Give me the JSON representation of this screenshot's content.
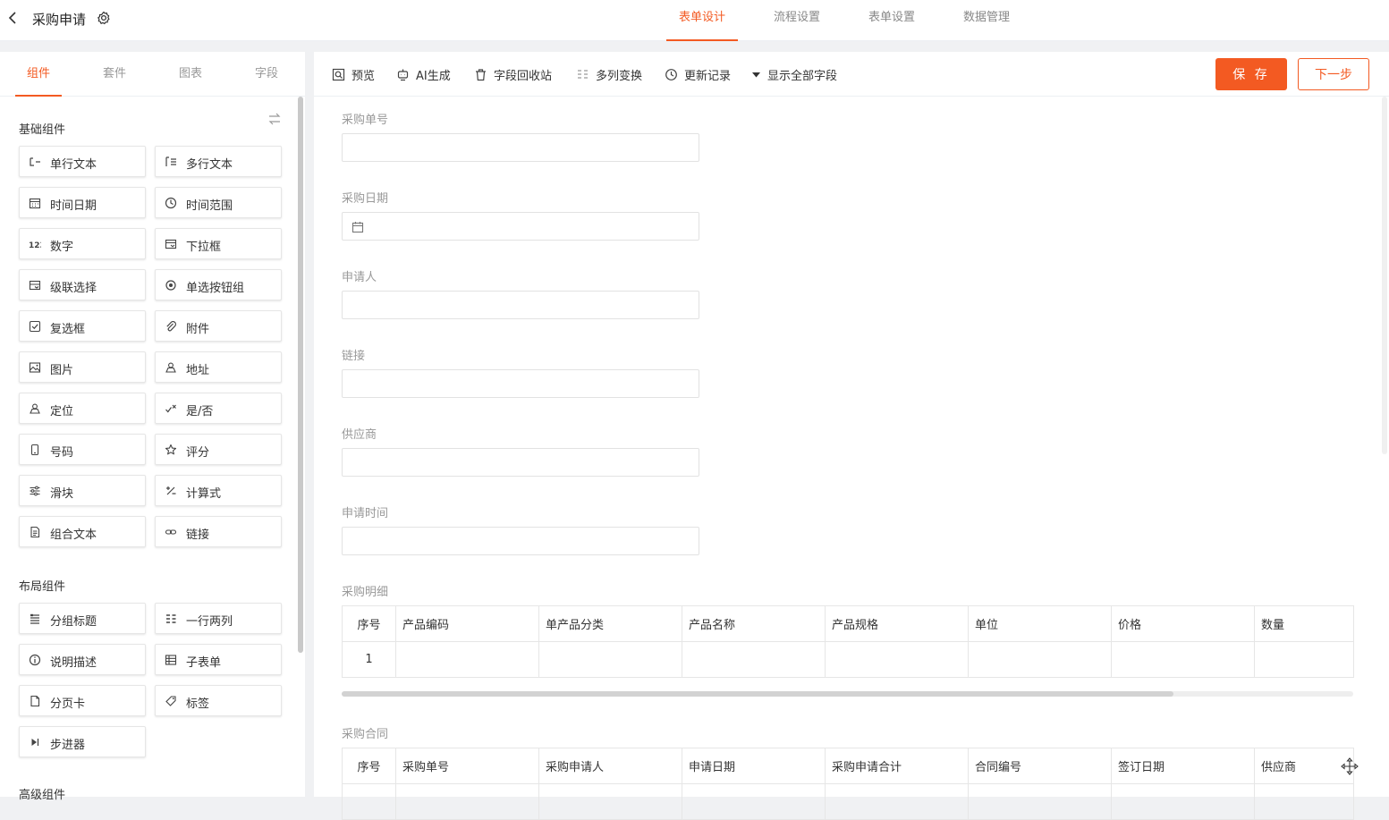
{
  "header": {
    "title": "采购申请",
    "tabs": [
      {
        "label": "表单设计",
        "active": true
      },
      {
        "label": "流程设置",
        "active": false
      },
      {
        "label": "表单设置",
        "active": false
      },
      {
        "label": "数据管理",
        "active": false
      }
    ],
    "accent_color": "#f35a22"
  },
  "left_panel": {
    "tabs": [
      {
        "label": "组件",
        "active": true
      },
      {
        "label": "套件",
        "active": false
      },
      {
        "label": "图表",
        "active": false
      },
      {
        "label": "字段",
        "active": false
      }
    ],
    "basic_title": "基础组件",
    "basic_components": [
      {
        "label": "单行文本",
        "icon": "single-line-text-icon"
      },
      {
        "label": "多行文本",
        "icon": "multi-line-text-icon"
      },
      {
        "label": "时间日期",
        "icon": "calendar-icon"
      },
      {
        "label": "时间范围",
        "icon": "clock-icon"
      },
      {
        "label": "数字",
        "icon": "number-icon"
      },
      {
        "label": "下拉框",
        "icon": "dropdown-icon"
      },
      {
        "label": "级联选择",
        "icon": "cascade-icon"
      },
      {
        "label": "单选按钮组",
        "icon": "radio-icon"
      },
      {
        "label": "复选框",
        "icon": "checkbox-icon"
      },
      {
        "label": "附件",
        "icon": "paperclip-icon"
      },
      {
        "label": "图片",
        "icon": "image-icon"
      },
      {
        "label": "地址",
        "icon": "map-icon"
      },
      {
        "label": "定位",
        "icon": "location-icon"
      },
      {
        "label": "是/否",
        "icon": "yes-no-icon"
      },
      {
        "label": "号码",
        "icon": "phone-icon"
      },
      {
        "label": "评分",
        "icon": "star-icon"
      },
      {
        "label": "滑块",
        "icon": "slider-icon"
      },
      {
        "label": "计算式",
        "icon": "formula-icon"
      },
      {
        "label": "组合文本",
        "icon": "document-icon"
      },
      {
        "label": "链接",
        "icon": "link-icon"
      }
    ],
    "layout_title": "布局组件",
    "layout_components": [
      {
        "label": "分组标题",
        "icon": "group-title-icon"
      },
      {
        "label": "一行两列",
        "icon": "two-columns-icon"
      },
      {
        "label": "说明描述",
        "icon": "info-icon"
      },
      {
        "label": "子表单",
        "icon": "table-icon"
      },
      {
        "label": "分页卡",
        "icon": "page-icon"
      },
      {
        "label": "标签",
        "icon": "tag-icon"
      },
      {
        "label": "步进器",
        "icon": "stepper-icon"
      }
    ],
    "advanced_title": "高级组件"
  },
  "toolbar": {
    "items": [
      {
        "label": "预览",
        "icon": "preview-icon"
      },
      {
        "label": "AI生成",
        "icon": "ai-robot-icon"
      },
      {
        "label": "字段回收站",
        "icon": "trash-icon"
      },
      {
        "label": "多列变换",
        "icon": "columns-icon"
      },
      {
        "label": "更新记录",
        "icon": "history-icon"
      },
      {
        "label": "显示全部字段",
        "icon": "caret-down-icon"
      }
    ],
    "save_label": "保 存",
    "next_label": "下一步"
  },
  "form": {
    "fields": [
      {
        "label": "采购单号",
        "value": ""
      },
      {
        "label": "采购日期",
        "value": "",
        "icon": "calendar-icon"
      },
      {
        "label": "申请人",
        "value": ""
      },
      {
        "label": "链接",
        "value": ""
      },
      {
        "label": "供应商",
        "value": ""
      },
      {
        "label": "申请时间",
        "value": ""
      }
    ],
    "detail_title": "采购明细",
    "detail_columns": [
      "序号",
      "产品编码",
      "单产品分类",
      "产品名称",
      "产品规格",
      "单位",
      "价格",
      "数量"
    ],
    "detail_rows": [
      [
        "1",
        "",
        "",
        "",
        "",
        "",
        "",
        ""
      ]
    ],
    "contract_title": "采购合同",
    "contract_columns": [
      "序号",
      "采购单号",
      "采购申请人",
      "申请日期",
      "采购申请合计",
      "合同编号",
      "签订日期",
      "供应商"
    ]
  }
}
